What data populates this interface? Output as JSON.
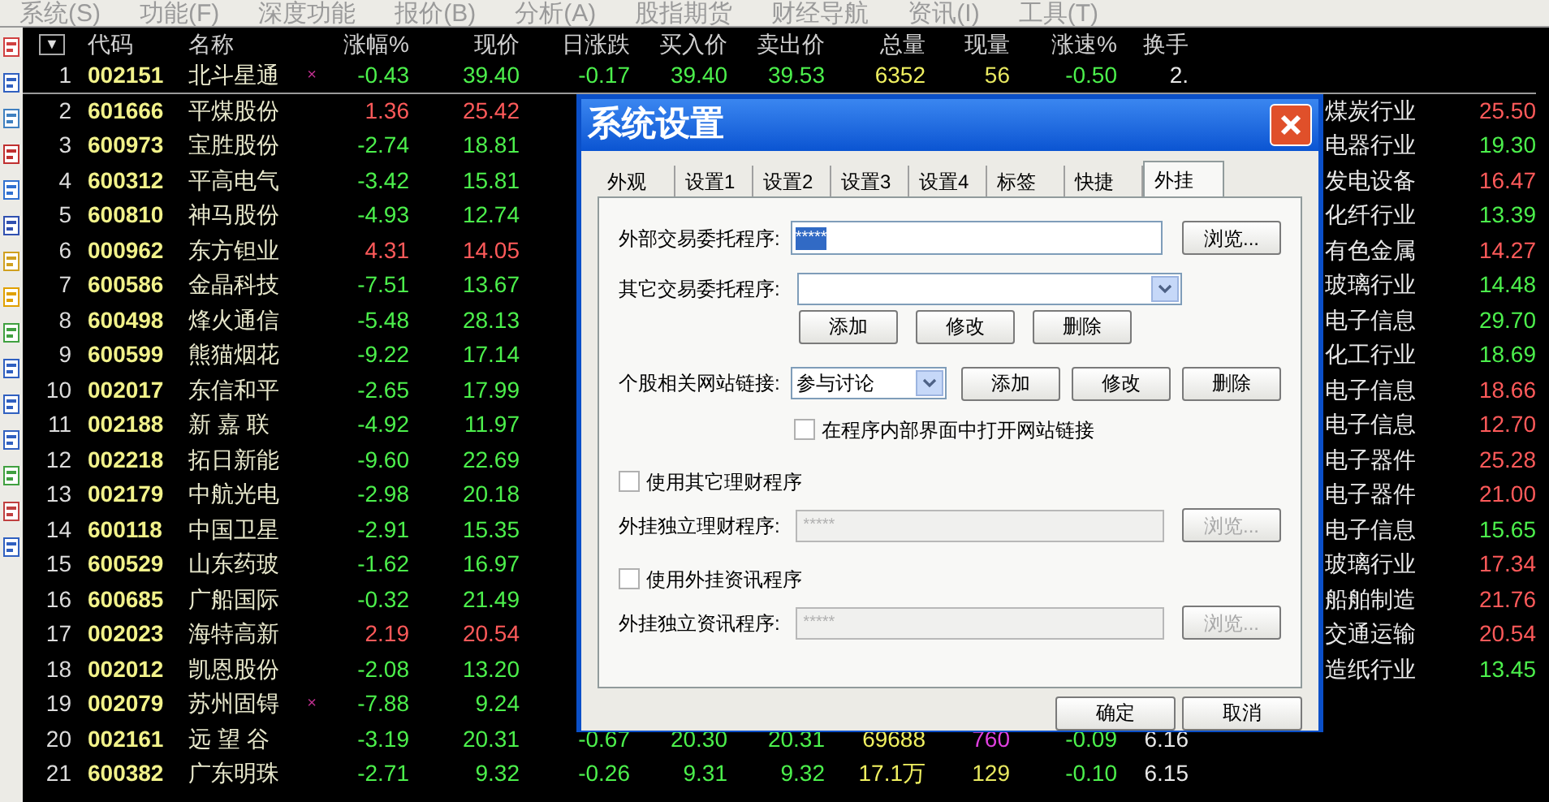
{
  "menu": [
    "系统(S)",
    "功能(F)",
    "深度功能",
    "报价(B)",
    "分析(A)",
    "股指期货",
    "财经导航",
    "资讯(I)",
    "工具(T)"
  ],
  "table": {
    "column_menu": "▼",
    "columns": [
      "代码",
      "名称",
      "涨幅%",
      "现价",
      "日涨跌",
      "买入价",
      "卖出价",
      "总量",
      "现量",
      "涨速%",
      "换手"
    ],
    "rows": [
      {
        "no": "1",
        "code": "002151",
        "name": "北斗星通",
        "flag": "×",
        "change": "-0.43",
        "price": "39.40",
        "up": false,
        "selected": true,
        "day_change": "-0.17",
        "bid": "39.40",
        "ask": "39.53",
        "volume": "6352",
        "current_volume": "56",
        "sell_volume": false,
        "speed": "-0.50",
        "turnover": "2."
      },
      {
        "no": "2",
        "code": "601666",
        "name": "平煤股份",
        "change": "1.36",
        "price": "25.42",
        "up": true,
        "selected": false,
        "industry": "煤炭行业",
        "last": "25.50",
        "last_up": true
      },
      {
        "no": "3",
        "code": "600973",
        "name": "宝胜股份",
        "change": "-2.74",
        "price": "18.81",
        "up": false,
        "selected": false,
        "industry": "电器行业",
        "last": "19.30",
        "last_up": false
      },
      {
        "no": "4",
        "code": "600312",
        "name": "平高电气",
        "change": "-3.42",
        "price": "15.81",
        "up": false,
        "selected": false,
        "industry": "发电设备",
        "last": "16.47",
        "last_up": true
      },
      {
        "no": "5",
        "code": "600810",
        "name": "神马股份",
        "change": "-4.93",
        "price": "12.74",
        "up": false,
        "selected": false,
        "industry": "化纤行业",
        "last": "13.39",
        "last_up": false
      },
      {
        "no": "6",
        "code": "000962",
        "name": "东方钽业",
        "change": "4.31",
        "price": "14.05",
        "up": true,
        "selected": false,
        "industry": "有色金属",
        "last": "14.27",
        "last_up": true
      },
      {
        "no": "7",
        "code": "600586",
        "name": "金晶科技",
        "change": "-7.51",
        "price": "13.67",
        "up": false,
        "selected": false,
        "industry": "玻璃行业",
        "last": "14.48",
        "last_up": false
      },
      {
        "no": "8",
        "code": "600498",
        "name": "烽火通信",
        "change": "-5.48",
        "price": "28.13",
        "up": false,
        "selected": false,
        "industry": "电子信息",
        "last": "29.70",
        "last_up": false
      },
      {
        "no": "9",
        "code": "600599",
        "name": "熊猫烟花",
        "change": "-9.22",
        "price": "17.14",
        "up": false,
        "selected": false,
        "industry": "化工行业",
        "last": "18.69",
        "last_up": false
      },
      {
        "no": "10",
        "code": "002017",
        "name": "东信和平",
        "change": "-2.65",
        "price": "17.99",
        "up": false,
        "selected": false,
        "industry": "电子信息",
        "last": "18.66",
        "last_up": true
      },
      {
        "no": "11",
        "code": "002188",
        "name": "新 嘉 联",
        "change": "-4.92",
        "price": "11.97",
        "up": false,
        "selected": false,
        "industry": "电子信息",
        "last": "12.70",
        "last_up": true
      },
      {
        "no": "12",
        "code": "002218",
        "name": "拓日新能",
        "change": "-9.60",
        "price": "22.69",
        "up": false,
        "selected": false,
        "industry": "电子器件",
        "last": "25.28",
        "last_up": true
      },
      {
        "no": "13",
        "code": "002179",
        "name": "中航光电",
        "change": "-2.98",
        "price": "20.18",
        "up": false,
        "selected": false,
        "industry": "电子器件",
        "last": "21.00",
        "last_up": true
      },
      {
        "no": "14",
        "code": "600118",
        "name": "中国卫星",
        "change": "-2.91",
        "price": "15.35",
        "up": false,
        "selected": false,
        "industry": "电子信息",
        "last": "15.65",
        "last_up": false
      },
      {
        "no": "15",
        "code": "600529",
        "name": "山东药玻",
        "change": "-1.62",
        "price": "16.97",
        "up": false,
        "selected": false,
        "industry": "玻璃行业",
        "last": "17.34",
        "last_up": true
      },
      {
        "no": "16",
        "code": "600685",
        "name": "广船国际",
        "change": "-0.32",
        "price": "21.49",
        "up": false,
        "selected": false,
        "industry": "船舶制造",
        "last": "21.76",
        "last_up": true
      },
      {
        "no": "17",
        "code": "002023",
        "name": "海特高新",
        "change": "2.19",
        "price": "20.54",
        "up": true,
        "selected": false,
        "industry": "交通运输",
        "last": "20.54",
        "last_up": true
      },
      {
        "no": "18",
        "code": "002012",
        "name": "凯恩股份",
        "change": "-2.08",
        "price": "13.20",
        "up": false,
        "selected": false,
        "industry": "造纸行业",
        "last": "13.45",
        "last_up": false
      },
      {
        "no": "19",
        "code": "002079",
        "name": "苏州固锝",
        "flag": "×",
        "change": "-7.88",
        "price": "9.24",
        "up": false,
        "selected": false
      },
      {
        "no": "20",
        "code": "002161",
        "name": "远 望 谷",
        "change": "-3.19",
        "price": "20.31",
        "up": false,
        "selected": false,
        "day_change": "-0.67",
        "bid": "20.30",
        "ask": "20.31",
        "volume": "69688",
        "current_volume": "760",
        "sell_volume": true,
        "speed": "-0.09",
        "turnover": "6.16"
      },
      {
        "no": "21",
        "code": "600382",
        "name": "广东明珠",
        "change": "-2.71",
        "price": "9.32",
        "up": false,
        "selected": false,
        "day_change": "-0.26",
        "bid": "9.31",
        "ask": "9.32",
        "volume": "17.1万",
        "current_volume": "129",
        "sell_volume": false,
        "speed": "-0.10",
        "turnover": "6.15"
      }
    ]
  },
  "dialog": {
    "title": "系统设置",
    "tabs": [
      {
        "label": "外观",
        "selected": false
      },
      {
        "label": "设置1",
        "selected": false
      },
      {
        "label": "设置2",
        "selected": false
      },
      {
        "label": "设置3",
        "selected": false
      },
      {
        "label": "设置4",
        "selected": false
      },
      {
        "label": "标签",
        "selected": false
      },
      {
        "label": "快捷",
        "selected": false
      },
      {
        "label": "外挂",
        "selected": true
      }
    ],
    "external_trade": {
      "label": "外部交易委托程序:",
      "value": "*****",
      "browse": "浏览..."
    },
    "other_trade": {
      "label": "其它交易委托程序:",
      "buttons": [
        "添加",
        "修改",
        "删除"
      ]
    },
    "site_link": {
      "label": "个股相关网站链接:",
      "value": "参与讨论",
      "buttons": [
        "添加",
        "修改",
        "删除"
      ]
    },
    "open_inside": {
      "label": "在程序内部界面中打开网站链接",
      "checked": false
    },
    "finance": {
      "checkbox": {
        "label": "使用其它理财程序",
        "checked": false
      },
      "label": "外挂独立理财程序:",
      "placeholder": "*****",
      "browse": "浏览...",
      "disabled": true
    },
    "news": {
      "checkbox": {
        "label": "使用外挂资讯程序",
        "checked": false
      },
      "label": "外挂独立资讯程序:",
      "placeholder": "*****",
      "browse": "浏览...",
      "disabled": true
    },
    "buttons": [
      "确定",
      "取消"
    ]
  }
}
